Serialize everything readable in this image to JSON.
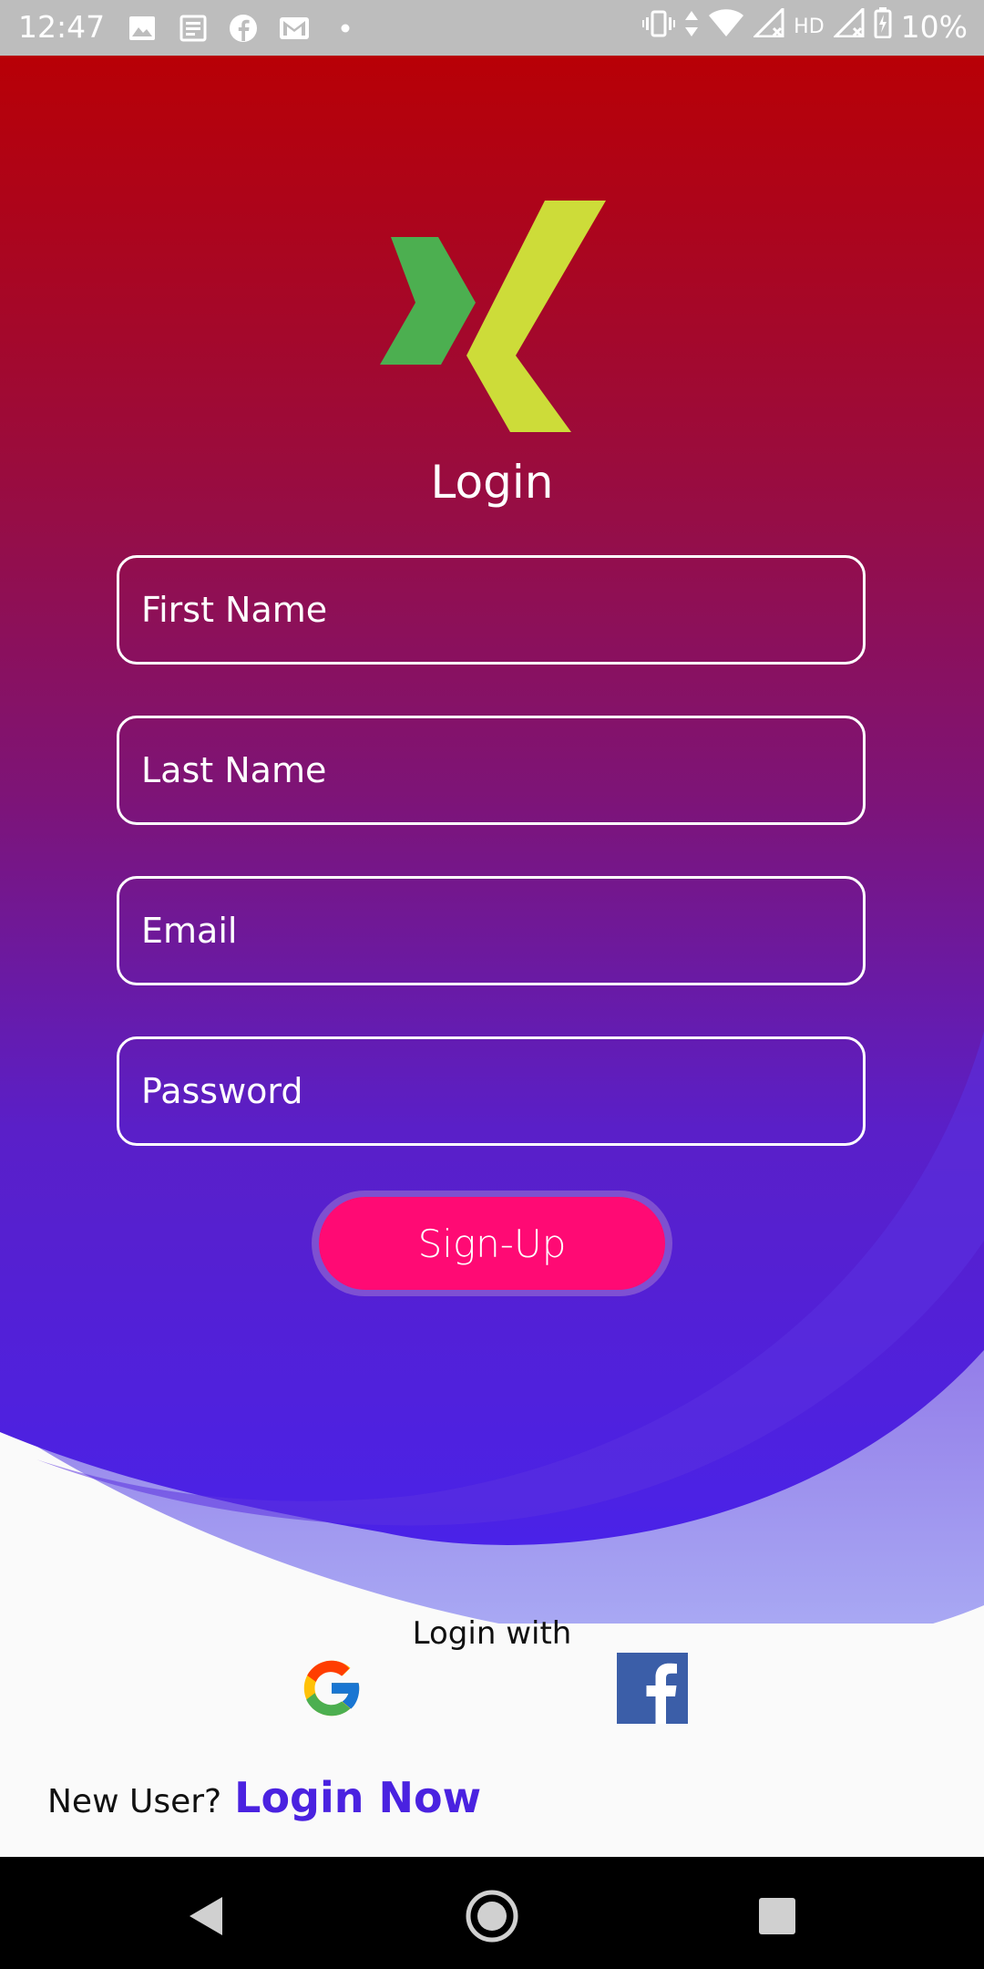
{
  "status_bar": {
    "time": "12:47",
    "network": "HD",
    "battery": "10%",
    "icons": [
      "image-icon",
      "news-icon",
      "facebook-icon",
      "gmail-icon",
      "dot-icon",
      "vibrate-icon",
      "data-arrows-icon",
      "wifi-icon",
      "signal-icon",
      "signal-icon-2",
      "battery-icon"
    ]
  },
  "login": {
    "title": "Login",
    "first_name_placeholder": "First Name",
    "last_name_placeholder": "Last Name",
    "email_placeholder": "Email",
    "password_placeholder": "Password",
    "signup_label": "Sign-Up"
  },
  "social": {
    "label": "Login with",
    "providers": [
      "google-icon",
      "facebook-icon"
    ]
  },
  "footer": {
    "question": "New User?",
    "link_label": "Login Now"
  },
  "colors": {
    "gradient_top": "#b80006",
    "gradient_bottom": "#4a22e8",
    "accent_button": "#ff0a74",
    "link": "#4a22e0",
    "logo_green": "#4caf50",
    "logo_yellow": "#cddc39"
  },
  "navigation": {
    "buttons": [
      "back-icon",
      "home-icon",
      "recents-icon"
    ]
  }
}
